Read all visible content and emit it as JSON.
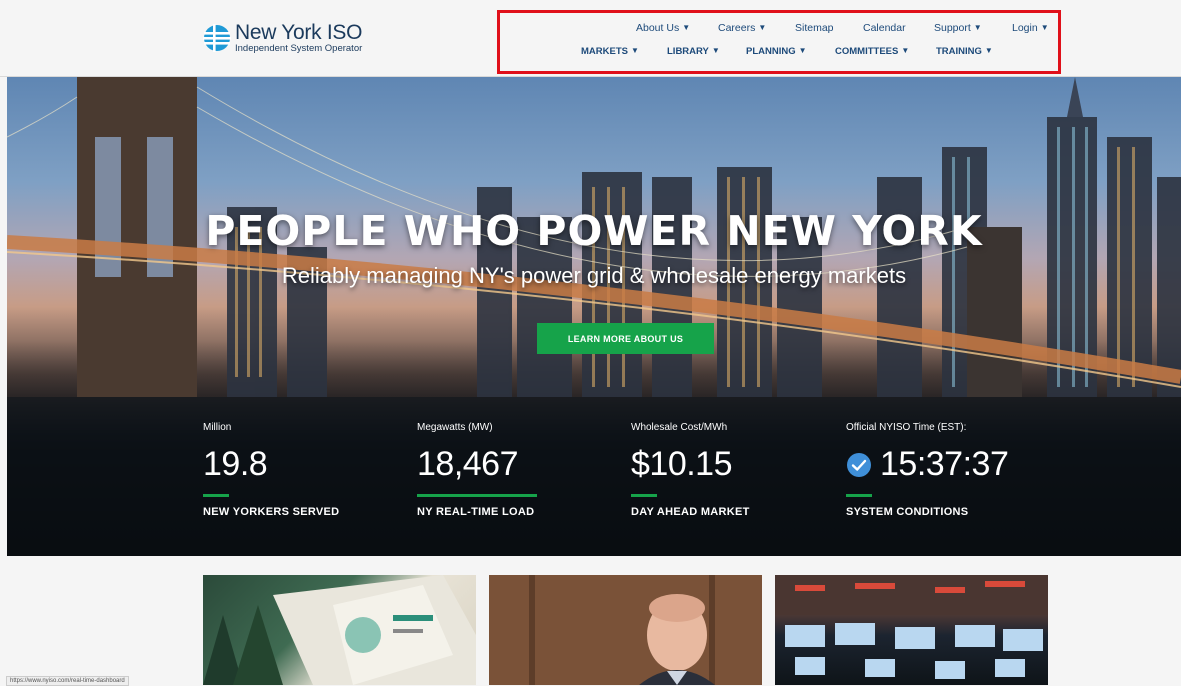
{
  "brand": {
    "name": "New York ISO",
    "subtitle": "Independent System Operator"
  },
  "nav": {
    "utility": [
      {
        "label": "About Us",
        "dropdown": true
      },
      {
        "label": "Careers",
        "dropdown": true
      },
      {
        "label": "Sitemap",
        "dropdown": false
      },
      {
        "label": "Calendar",
        "dropdown": false
      },
      {
        "label": "Support",
        "dropdown": true
      },
      {
        "label": "Login",
        "dropdown": true
      }
    ],
    "main": [
      {
        "label": "MARKETS",
        "dropdown": true
      },
      {
        "label": "LIBRARY",
        "dropdown": true
      },
      {
        "label": "PLANNING",
        "dropdown": true
      },
      {
        "label": "COMMITTEES",
        "dropdown": true
      },
      {
        "label": "TRAINING",
        "dropdown": true
      }
    ],
    "chevron": "⌄",
    "search_icon": "search-icon"
  },
  "hero": {
    "title": "PEOPLE WHO POWER NEW YORK",
    "subtitle": "Reliably managing NY's power grid & wholesale energy markets",
    "cta_label": "LEARN MORE ABOUT US"
  },
  "stats": [
    {
      "top": "Million",
      "value": "19.8",
      "label": "NEW YORKERS SERVED"
    },
    {
      "top": "Megawatts (MW)",
      "value": "18,467",
      "label": "NY REAL-TIME LOAD"
    },
    {
      "top": "Wholesale Cost/MWh",
      "value": "$10.15",
      "label": "DAY AHEAD MARKET"
    },
    {
      "top": "Official NYISO Time (EST):",
      "value": "15:37:37",
      "label": "SYSTEM CONDITIONS",
      "icon": "check-circle-icon"
    }
  ],
  "status_bar": {
    "url": "https://www.nyiso.com/real-time-dashboard"
  },
  "colors": {
    "accent_green": "#16a34a",
    "nav_blue": "#1d4a7a",
    "highlight_red": "#e0101a",
    "check_blue": "#3f8fd8"
  }
}
